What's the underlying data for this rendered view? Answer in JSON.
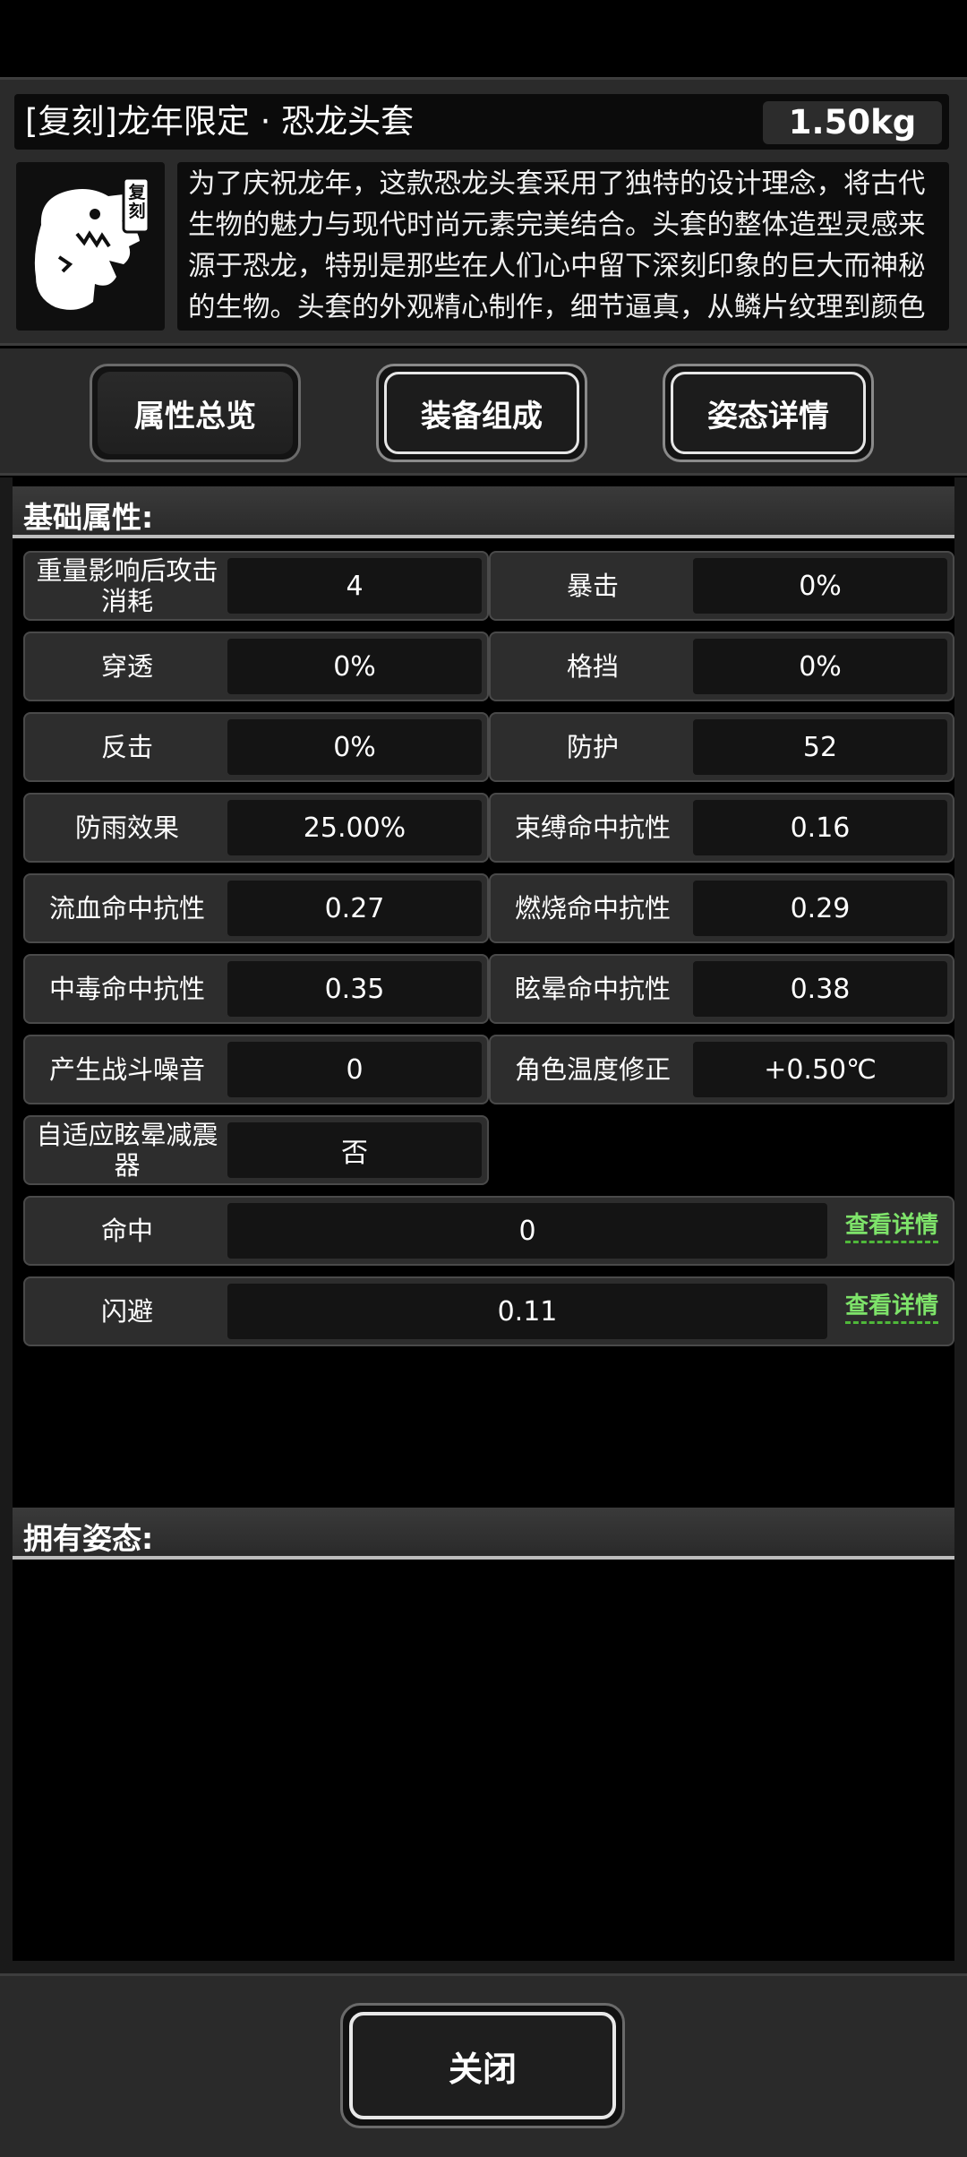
{
  "header": {
    "title": "[复刻]龙年限定 · 恐龙头套",
    "weight": "1.50kg",
    "badge": "复刻",
    "description": "为了庆祝龙年，这款恐龙头套采用了独特的设计理念，将古代生物的魅力与现代时尚元素完美结合。头套的整体造型灵感来源于恐龙，特别是那些在人们心中留下深刻印象的巨大而神秘的生物。头套的外观精心制作，细节逼真，从鳞片纹理到颜色搭配，都力求还原一个真实的恐龙头部形象。色彩上以深绿和浅棕色为"
  },
  "tabs": [
    {
      "label": "属性总览"
    },
    {
      "label": "装备组成"
    },
    {
      "label": "姿态详情"
    }
  ],
  "basic": {
    "heading": "基础属性:",
    "rows": [
      {
        "l_label": "重量影响后攻击消耗",
        "l_val": "4",
        "r_label": "暴击",
        "r_val": "0%"
      },
      {
        "l_label": "穿透",
        "l_val": "0%",
        "r_label": "格挡",
        "r_val": "0%"
      },
      {
        "l_label": "反击",
        "l_val": "0%",
        "r_label": "防护",
        "r_val": "52"
      },
      {
        "l_label": "防雨效果",
        "l_val": "25.00%",
        "r_label": "束缚命中抗性",
        "r_val": "0.16"
      },
      {
        "l_label": "流血命中抗性",
        "l_val": "0.27",
        "r_label": "燃烧命中抗性",
        "r_val": "0.29"
      },
      {
        "l_label": "中毒命中抗性",
        "l_val": "0.35",
        "r_label": "眩晕命中抗性",
        "r_val": "0.38"
      },
      {
        "l_label": "产生战斗噪音",
        "l_val": "0",
        "r_label": "角色温度修正",
        "r_val": "+0.50℃"
      },
      {
        "l_label": "自适应眩晕减震器",
        "l_val": "否"
      }
    ],
    "hit": {
      "label": "命中",
      "value": "0",
      "detail": "查看详情"
    },
    "dodge": {
      "label": "闪避",
      "value": "0.11",
      "detail": "查看详情"
    }
  },
  "posture": {
    "heading": "拥有姿态:"
  },
  "footer": {
    "close_label": "关闭"
  }
}
